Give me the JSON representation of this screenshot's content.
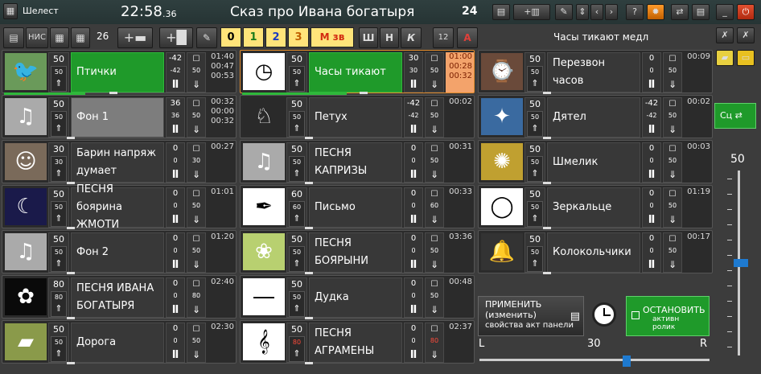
{
  "window": {
    "app_name": "Шелест",
    "time": "22:58",
    "time_sub": ".36",
    "title": "Сказ про Ивана богатыря",
    "count": "24"
  },
  "toolbar": {
    "nis": "НИС",
    "page_num": "26",
    "plus1": "+",
    "plus2": "+",
    "nums": [
      "0",
      "1",
      "2",
      "3"
    ],
    "mzv": "М зв",
    "sh": "Ш",
    "n": "Н",
    "k": "К",
    "size": "12",
    "a": "А",
    "status": "Часы тикают медл"
  },
  "colors": {
    "green": "#1f9a2a",
    "orange": "#e08a2a",
    "yellow": "#ffe47a",
    "red": "#d32a10"
  },
  "col1": [
    {
      "vol": "50",
      "vol2": "50",
      "name": "Птички",
      "cv": "-42",
      "cv2": "-42",
      "ck2": "50",
      "t": [
        "01:40",
        "00:47",
        "00:53"
      ],
      "style": "green",
      "icon": "bird-icon",
      "progress": 0.35
    },
    {
      "vol": "50",
      "vol2": "50",
      "name": "Фон 1",
      "cv": "36",
      "cv2": "36",
      "ck2": "50",
      "t": [
        "00:32",
        "00:00",
        "00:32"
      ],
      "style": "gray",
      "icon": "music-notes-icon",
      "progress": 0
    },
    {
      "vol": "30",
      "vol2": "30",
      "name": "Барин напряж думает",
      "cv": "0",
      "cv2": "0",
      "ck2": "30",
      "t": [
        "",
        "",
        "00:27"
      ],
      "style": "",
      "icon": "man-portrait-icon",
      "progress": 0
    },
    {
      "vol": "50",
      "vol2": "50",
      "name": "ПЕСНЯ боярина ЖМОТИ",
      "cv": "0",
      "cv2": "0",
      "ck2": "50",
      "t": [
        "",
        "",
        "01:01"
      ],
      "style": "",
      "icon": "moon-night-icon",
      "progress": 0
    },
    {
      "vol": "50",
      "vol2": "50",
      "name": "Фон 2",
      "cv": "0",
      "cv2": "0",
      "ck2": "50",
      "t": [
        "",
        "",
        "01:20"
      ],
      "style": "",
      "icon": "music-notes-icon",
      "progress": 0
    },
    {
      "vol": "80",
      "vol2": "80",
      "name": "ПЕСНЯ ИВАНА БОГАТЫРЯ",
      "cv": "0",
      "cv2": "0",
      "ck2": "80",
      "t": [
        "",
        "",
        "02:40"
      ],
      "style": "",
      "icon": "flower-icon",
      "progress": 0
    },
    {
      "vol": "50",
      "vol2": "50",
      "name": "Дорога",
      "cv": "0",
      "cv2": "0",
      "ck2": "50",
      "t": [
        "",
        "",
        "02:30"
      ],
      "style": "",
      "icon": "road-landscape-icon",
      "progress": 0
    }
  ],
  "col2": [
    {
      "vol": "50",
      "vol2": "50",
      "name": "Часы тикают",
      "cv": "30",
      "cv2": "30",
      "ck2": "50",
      "t": [
        "01:00",
        "00:28",
        "00:32"
      ],
      "style": "green",
      "sel": true,
      "org": true,
      "icon": "clock-icon",
      "progress": 0.45
    },
    {
      "vol": "50",
      "vol2": "50",
      "name": "Петух",
      "cv": "-42",
      "cv2": "-42",
      "ck2": "50",
      "t": [
        "",
        "",
        "00:02"
      ],
      "style": "",
      "icon": "rooster-icon",
      "progress": 0
    },
    {
      "vol": "50",
      "vol2": "50",
      "name": "ПЕСНЯ КАПРИЗЫ",
      "cv": "0",
      "cv2": "0",
      "ck2": "50",
      "t": [
        "",
        "",
        "00:31"
      ],
      "style": "",
      "icon": "music-notes-icon",
      "progress": 0
    },
    {
      "vol": "60",
      "vol2": "60",
      "name": "Письмо",
      "cv": "0",
      "cv2": "0",
      "ck2": "60",
      "t": [
        "",
        "",
        "00:33"
      ],
      "style": "",
      "icon": "feather-icon",
      "progress": 0
    },
    {
      "vol": "50",
      "vol2": "50",
      "name": "ПЕСНЯ БОЯРЫНИ",
      "cv": "0",
      "cv2": "0",
      "ck2": "50",
      "t": [
        "",
        "",
        "03:36"
      ],
      "style": "",
      "icon": "meadow-icon",
      "progress": 0
    },
    {
      "vol": "50",
      "vol2": "50",
      "name": "Дудка",
      "cv": "0",
      "cv2": "0",
      "ck2": "50",
      "t": [
        "",
        "",
        "00:48"
      ],
      "style": "",
      "icon": "flute-icon",
      "progress": 0
    },
    {
      "vol": "50",
      "vol2": "80",
      "name": "ПЕСНЯ АГРАМЕНЫ",
      "cv": "0",
      "cv2": "0",
      "ck2": "80",
      "t": [
        "",
        "",
        "02:37"
      ],
      "style": "",
      "red": true,
      "icon": "sheet-music-icon",
      "progress": 0
    }
  ],
  "col3": [
    {
      "vol": "50",
      "vol2": "50",
      "name": "Перезвон часов",
      "cv": "0",
      "cv2": "0",
      "ck2": "50",
      "t": [
        "",
        "",
        "00:09"
      ],
      "style": "",
      "icon": "grandfather-clock-icon",
      "progress": 0
    },
    {
      "vol": "50",
      "vol2": "50",
      "name": "Дятел",
      "cv": "-42",
      "cv2": "-42",
      "ck2": "50",
      "t": [
        "",
        "",
        "00:02"
      ],
      "style": "",
      "icon": "woodpecker-icon",
      "progress": 0
    },
    {
      "vol": "50",
      "vol2": "50",
      "name": "Шмелик",
      "cv": "0",
      "cv2": "0",
      "ck2": "50",
      "t": [
        "",
        "",
        "00:03"
      ],
      "style": "",
      "icon": "bumblebee-icon",
      "progress": 0
    },
    {
      "vol": "50",
      "vol2": "50",
      "name": "Зеркальце",
      "cv": "0",
      "cv2": "0",
      "ck2": "50",
      "t": [
        "",
        "",
        "01:19"
      ],
      "style": "",
      "icon": "mirror-icon",
      "progress": 0
    },
    {
      "vol": "50",
      "vol2": "50",
      "name": "Колокольчики",
      "cv": "0",
      "cv2": "0",
      "ck2": "50",
      "t": [
        "",
        "",
        "00:17"
      ],
      "style": "",
      "icon": "bell-icon",
      "progress": 0
    }
  ],
  "bottom": {
    "apply_l1": "ПРИМЕНИТЬ",
    "apply_l2": "(изменить)",
    "apply_l3": "свойства акт панели",
    "stop_l1": "ОСТАНОВИТЬ",
    "stop_l2": "активн ролик",
    "l": "L",
    "r": "R",
    "balance": "30",
    "sc": "Сц"
  },
  "master": {
    "volume": "50",
    "level": 0.5
  }
}
